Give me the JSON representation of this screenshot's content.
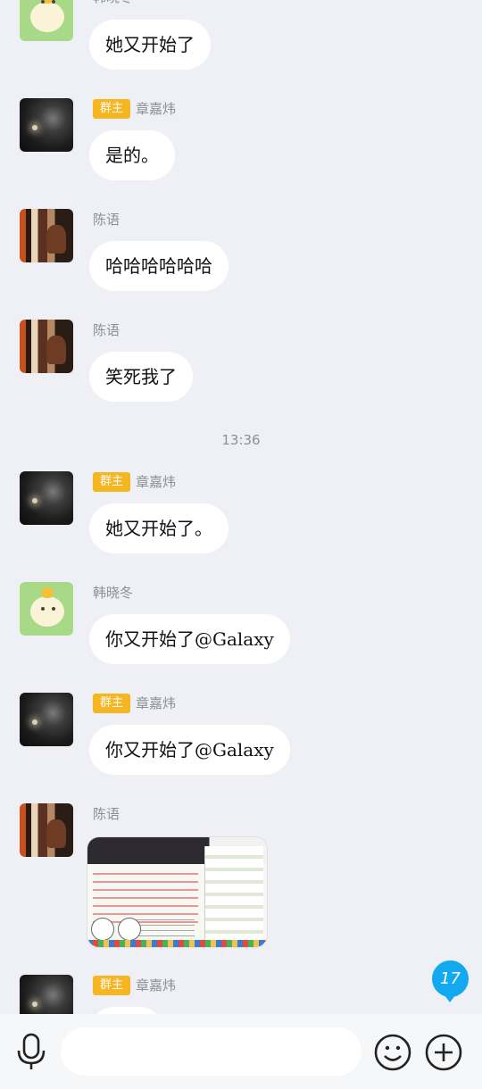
{
  "messages": [
    {
      "name": "韩晓冬",
      "text": "她又开始了"
    },
    {
      "badge": "群主",
      "name": "章嘉炜",
      "text": "是的。"
    },
    {
      "name": "陈语",
      "text": "哈哈哈哈哈哈"
    },
    {
      "name": "陈语",
      "text": "笑死我了"
    },
    {
      "name": "章嘉炜",
      "badge": "群主",
      "text": "她又开始了。"
    },
    {
      "name": "韩晓冬",
      "text": "你又开始了@Galaxy"
    },
    {
      "name": "章嘉炜",
      "badge": "群主",
      "text": "你又开始了@Galaxy"
    },
    {
      "name": "陈语",
      "image": "screenshot-image"
    },
    {
      "name": "章嘉炜",
      "badge": "群主"
    }
  ],
  "timestamp": "13:36",
  "unread_count": "17",
  "input": {
    "placeholder": ""
  },
  "icons": {
    "voice": "microphone-icon",
    "emoji": "smiley-icon",
    "more": "plus-circle-icon"
  },
  "colors": {
    "background": "#eef0f5",
    "badge": "#f5b622",
    "unread": "#12a9f0",
    "bubble": "#ffffff"
  }
}
